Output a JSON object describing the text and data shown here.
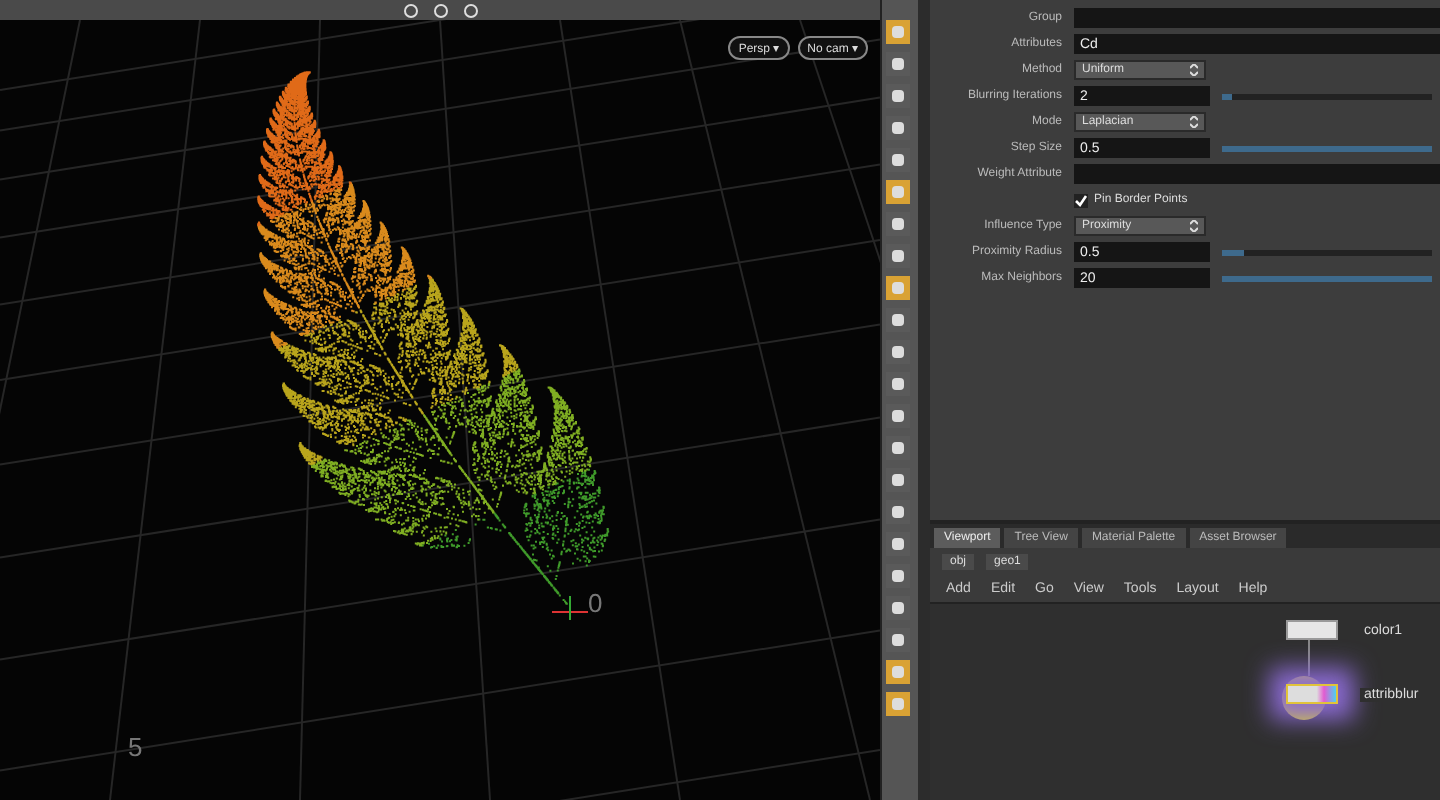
{
  "viewport": {
    "camera_menu": "Persp ▾",
    "display_menu": "No cam ▾",
    "axis_labels": [
      "0",
      "5"
    ]
  },
  "toolbar": [
    {
      "selected": true
    },
    {
      "selected": false
    },
    {
      "selected": false
    },
    {
      "selected": false
    },
    {
      "selected": false
    },
    {
      "selected": true
    },
    {
      "selected": false
    },
    {
      "selected": false
    },
    {
      "selected": true
    },
    {
      "selected": false
    },
    {
      "selected": false
    },
    {
      "selected": false
    },
    {
      "selected": false
    },
    {
      "selected": false
    },
    {
      "selected": false
    },
    {
      "selected": false
    },
    {
      "selected": false
    },
    {
      "selected": false
    },
    {
      "selected": false
    },
    {
      "selected": false
    },
    {
      "selected": true
    },
    {
      "selected": true
    }
  ],
  "parameters": [
    {
      "kind": "text",
      "label": "Group"
    },
    {
      "kind": "text",
      "label": "Attributes",
      "value": "Cd"
    },
    {
      "kind": "menu",
      "label": "Method",
      "value": "Uniform"
    },
    {
      "kind": "slider",
      "label": "Blurring Iterations",
      "value": "2",
      "level": 0.05
    },
    {
      "kind": "menu",
      "label": "Mode",
      "value": "Laplacian"
    },
    {
      "kind": "slider",
      "label": "Step Size",
      "value": "0.5",
      "level": 1
    },
    {
      "kind": "text",
      "label": "Weight Attribute"
    },
    {
      "kind": "checkbox",
      "label": "Pin Border Points",
      "checked": true
    },
    {
      "kind": "menu",
      "label": "Influence Type",
      "value": "Proximity"
    },
    {
      "kind": "slider",
      "label": "Proximity Radius",
      "value": "0.5",
      "level": 0.1
    },
    {
      "kind": "slider",
      "label": "Max Neighbors",
      "value": "20",
      "level": 1
    }
  ],
  "network": {
    "tabs": [
      {
        "label": "Viewport",
        "selected": true
      },
      {
        "label": "Tree View",
        "selected": false
      },
      {
        "label": "Material Palette",
        "selected": false
      },
      {
        "label": "Asset Browser",
        "selected": false
      }
    ],
    "path": [
      "obj",
      "geo1"
    ],
    "menu": [
      "Add",
      "Edit",
      "Go",
      "View",
      "Tools",
      "Layout",
      "Help"
    ],
    "nodes": [
      {
        "name": "color1",
        "selected": false
      },
      {
        "name": "attribblur",
        "selected": true
      }
    ]
  }
}
